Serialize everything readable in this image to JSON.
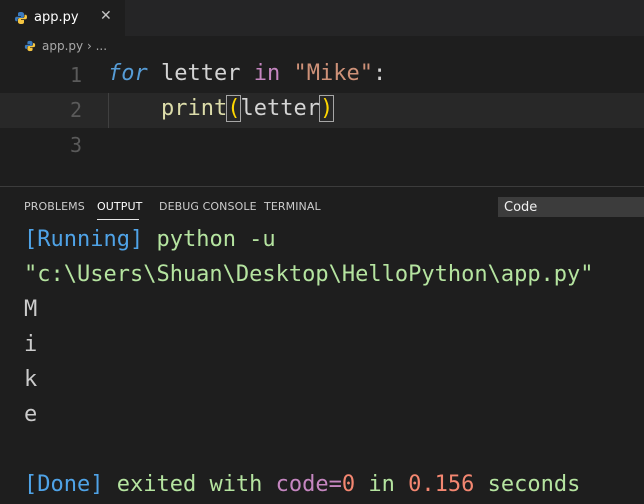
{
  "tab": {
    "filename": "app.py",
    "close_glyph": "✕",
    "icon": "python-icon"
  },
  "breadcrumb": {
    "file": "app.py",
    "separator": "›",
    "more": "..."
  },
  "editor": {
    "line_numbers": [
      "1",
      "2",
      "3"
    ],
    "line1": {
      "kw_for": "for",
      "var": " letter ",
      "kw_in": "in",
      "space": " ",
      "string": "\"Mike\"",
      "colon": ":"
    },
    "line2": {
      "indent": "    ",
      "func": "print",
      "open_paren": "(",
      "arg": "letter",
      "close_paren": ")"
    }
  },
  "panel": {
    "tabs": [
      "PROBLEMS",
      "OUTPUT",
      "DEBUG CONSOLE",
      "TERMINAL"
    ],
    "active_tab": "OUTPUT",
    "channel": "Code",
    "output": {
      "running_tag": "[Running]",
      "running_cmd": " python -u",
      "path": "\"c:\\Users\\Shuan\\Desktop\\HelloPython\\app.py\"",
      "letters": [
        "M",
        "i",
        "k",
        "e"
      ],
      "done_tag": "[Done]",
      "done_text1": " exited with ",
      "done_code": "code=",
      "done_code_val": "0",
      "done_in": " in ",
      "done_time": "0.156",
      "done_seconds": " seconds"
    }
  }
}
